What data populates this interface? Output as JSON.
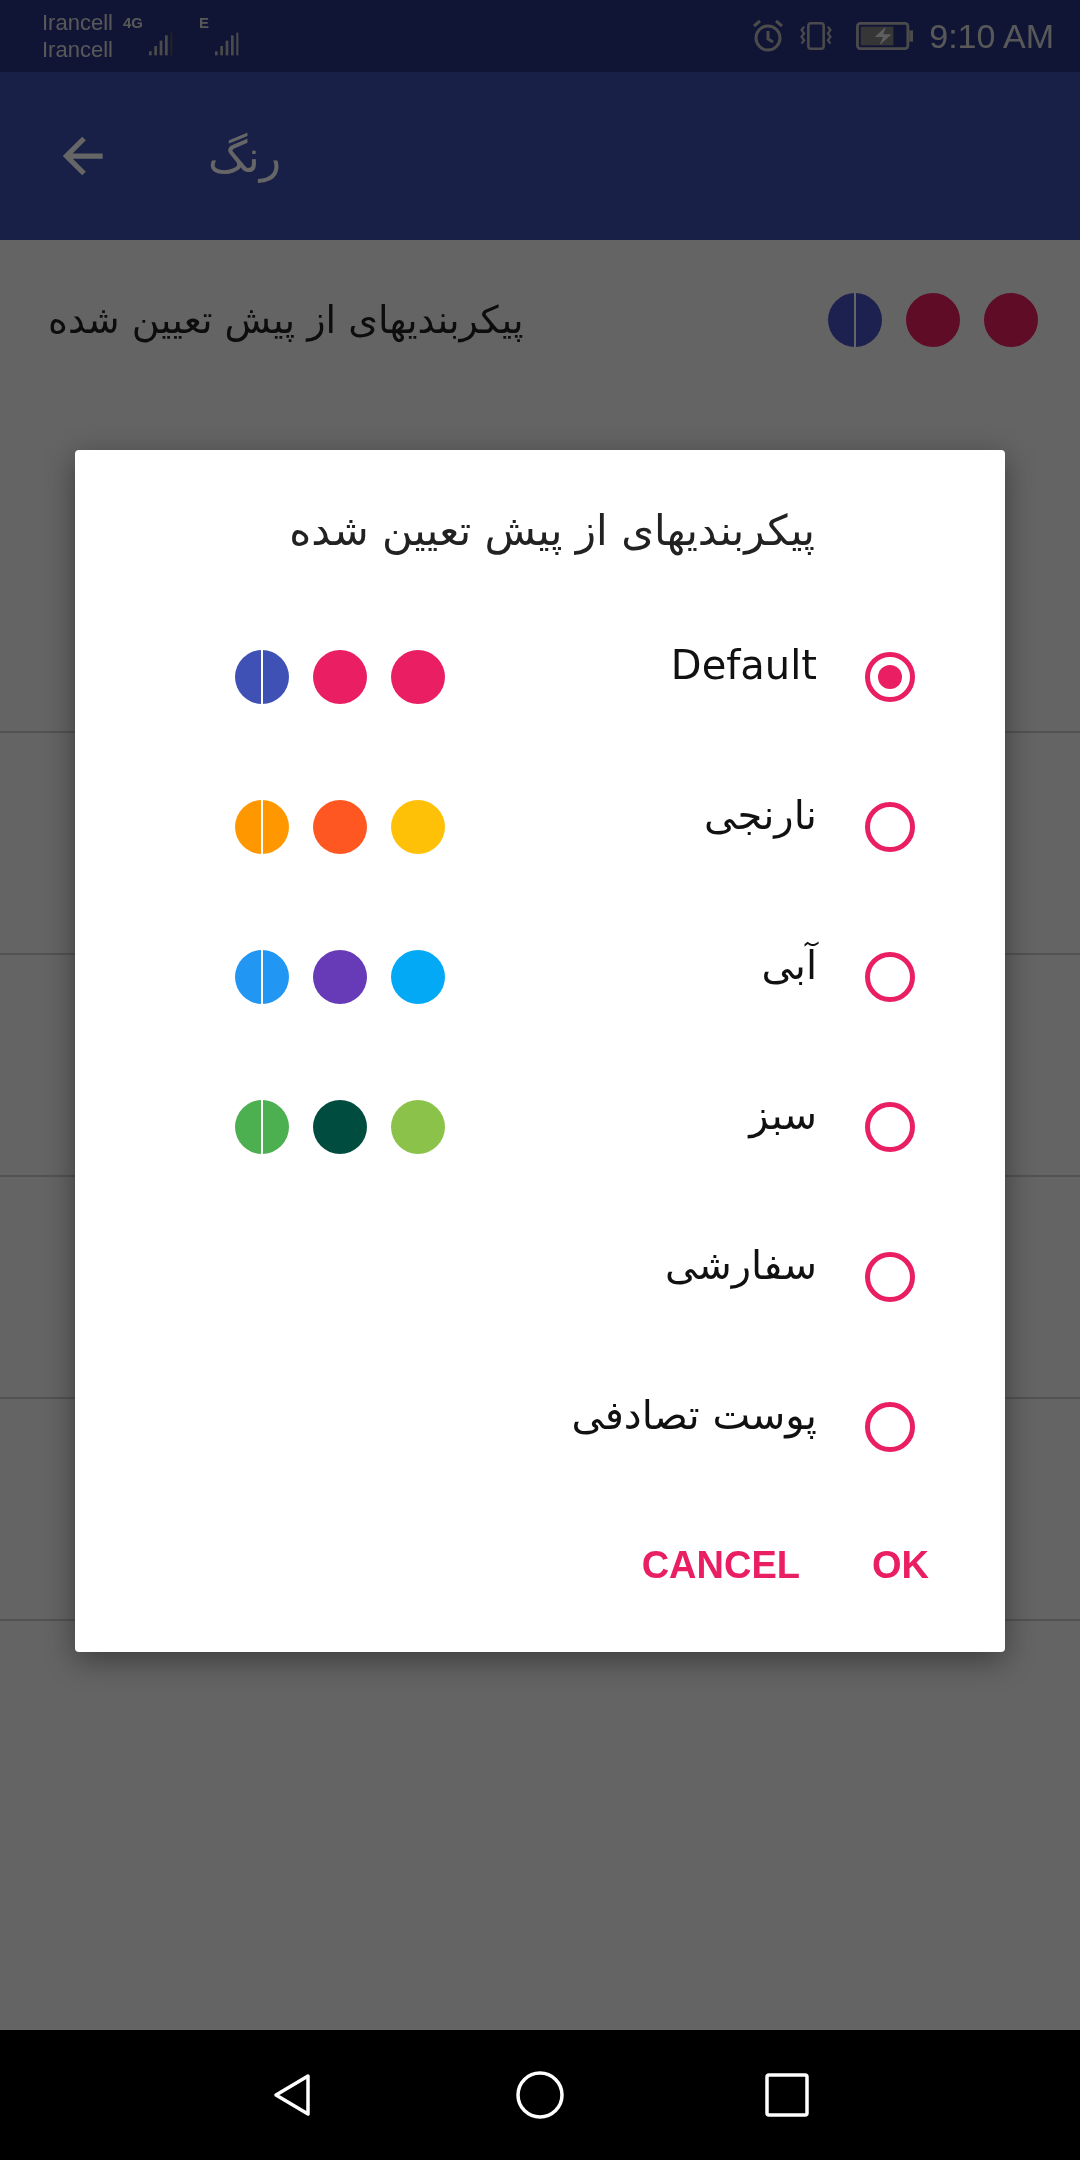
{
  "status_bar": {
    "carriers": [
      "Irancell",
      "Irancell"
    ],
    "network_1": "4G",
    "network_2": "E",
    "time": "9:10 AM"
  },
  "app_bar": {
    "title": "رنگ"
  },
  "settings": {
    "preset": {
      "label": "پیکربندیهای از پیش تعیین شده",
      "dots": [
        {
          "color": "#1c2150"
        },
        {
          "color": "#5f0c27"
        },
        {
          "color": "#5f0c27"
        }
      ]
    }
  },
  "dialog": {
    "title": "پیکربندیهای از پیش تعیین شده",
    "options": [
      {
        "label": "Default",
        "selected": true,
        "dots": [
          {
            "color": "#3f51b5"
          },
          {
            "color": "#e91e63"
          },
          {
            "color": "#e91e63"
          }
        ]
      },
      {
        "label": "نارنجی",
        "selected": false,
        "dots": [
          {
            "color": "#ff9800"
          },
          {
            "color": "#ff5722"
          },
          {
            "color": "#ffc107"
          }
        ]
      },
      {
        "label": "آبی",
        "selected": false,
        "dots": [
          {
            "color": "#2196f3"
          },
          {
            "color": "#673ab7"
          },
          {
            "color": "#03a9f4"
          }
        ]
      },
      {
        "label": "سبز",
        "selected": false,
        "dots": [
          {
            "color": "#4caf50"
          },
          {
            "color": "#004d40"
          },
          {
            "color": "#8bc34a"
          }
        ]
      },
      {
        "label": "سفارشی",
        "selected": false
      },
      {
        "label": "پوست تصادفی",
        "selected": false
      }
    ],
    "buttons": [
      "OK",
      "CANCEL"
    ]
  }
}
